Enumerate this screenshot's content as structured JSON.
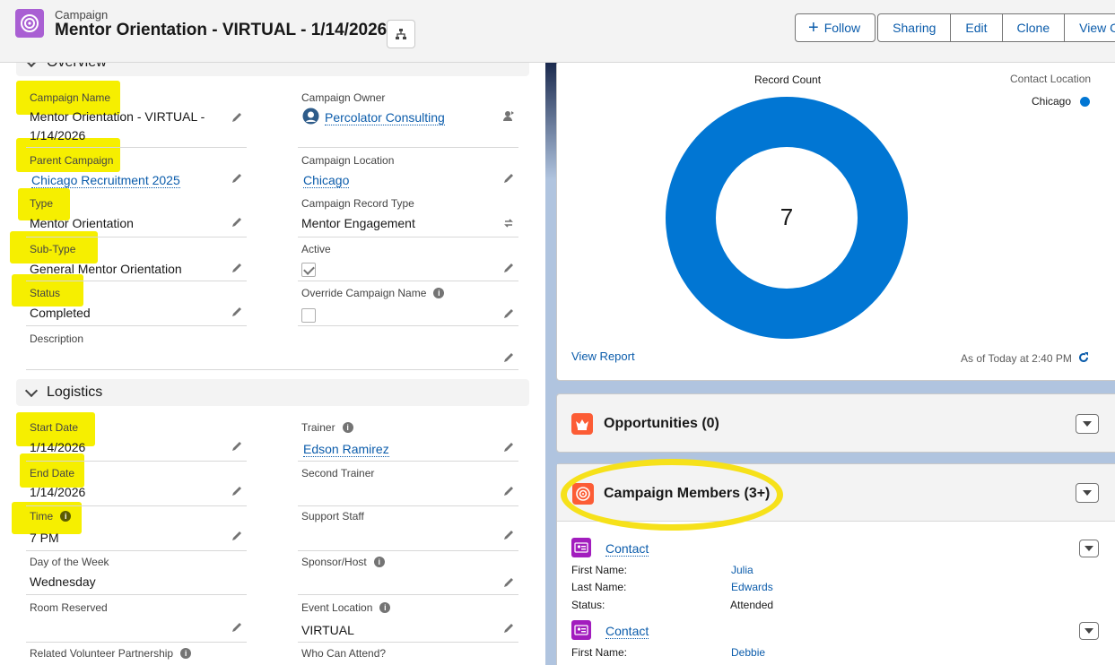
{
  "header": {
    "object_label": "Campaign",
    "title": "Mentor Orientation - VIRTUAL - 1/14/2026",
    "actions": {
      "follow": "Follow",
      "sharing": "Sharing",
      "edit": "Edit",
      "clone": "Clone",
      "view": "View Ca"
    }
  },
  "overview": {
    "section_title": "Overview",
    "campaign_name": {
      "label": "Campaign Name",
      "value": "Mentor Orientation - VIRTUAL - 1/14/2026"
    },
    "campaign_owner": {
      "label": "Campaign Owner",
      "value": "Percolator Consulting"
    },
    "parent_campaign": {
      "label": "Parent Campaign",
      "value": "Chicago Recruitment 2025"
    },
    "campaign_location": {
      "label": "Campaign Location",
      "value": "Chicago"
    },
    "type": {
      "label": "Type",
      "value": "Mentor Orientation"
    },
    "record_type": {
      "label": "Campaign Record Type",
      "value": "Mentor Engagement"
    },
    "sub_type": {
      "label": "Sub-Type",
      "value": "General Mentor Orientation"
    },
    "active": {
      "label": "Active",
      "checked": true
    },
    "status": {
      "label": "Status",
      "value": "Completed"
    },
    "override_name": {
      "label": "Override Campaign Name",
      "checked": false
    },
    "description": {
      "label": "Description",
      "value": ""
    }
  },
  "logistics": {
    "section_title": "Logistics",
    "start_date": {
      "label": "Start Date",
      "value": "1/14/2026"
    },
    "trainer": {
      "label": "Trainer",
      "value": "Edson Ramirez"
    },
    "end_date": {
      "label": "End Date",
      "value": "1/14/2026"
    },
    "second_trainer": {
      "label": "Second Trainer",
      "value": ""
    },
    "time": {
      "label": "Time",
      "value": "7 PM"
    },
    "support_staff": {
      "label": "Support Staff",
      "value": ""
    },
    "day_of_week": {
      "label": "Day of the Week",
      "value": "Wednesday"
    },
    "sponsor_host": {
      "label": "Sponsor/Host",
      "value": ""
    },
    "room_reserved": {
      "label": "Room Reserved",
      "value": ""
    },
    "event_location": {
      "label": "Event Location",
      "value": "VIRTUAL"
    },
    "related_partnership": {
      "label": "Related Volunteer Partnership"
    },
    "who_can_attend": {
      "label": "Who Can Attend?"
    }
  },
  "report_chart": {
    "view_report": "View Report",
    "as_of": "As of Today at 2:40 PM",
    "legend_title": "Contact Location",
    "center_value": "7"
  },
  "chart_data": {
    "type": "pie",
    "title": "Record Count",
    "categories": [
      "Chicago"
    ],
    "values": [
      7
    ],
    "legend": "top-right",
    "colors": [
      "#0176d3"
    ]
  },
  "opportunities": {
    "title": "Opportunities (0)"
  },
  "campaign_members": {
    "title": "Campaign Members (3+)",
    "members": [
      {
        "type": "Contact",
        "first_name_label": "First Name:",
        "first_name": "Julia",
        "last_name_label": "Last Name:",
        "last_name": "Edwards",
        "status_label": "Status:",
        "status": "Attended"
      },
      {
        "type": "Contact",
        "first_name_label": "First Name:",
        "first_name": "Debbie"
      }
    ]
  },
  "colors": {
    "campaign_icon": "#a95fd3",
    "opportunity_icon": "#fc5c35",
    "member_icon": "#fc5c35",
    "contact_icon": "#a21dbe",
    "highlight": "#f6ef00",
    "link": "#0b5cab",
    "chart": "#0176d3"
  }
}
